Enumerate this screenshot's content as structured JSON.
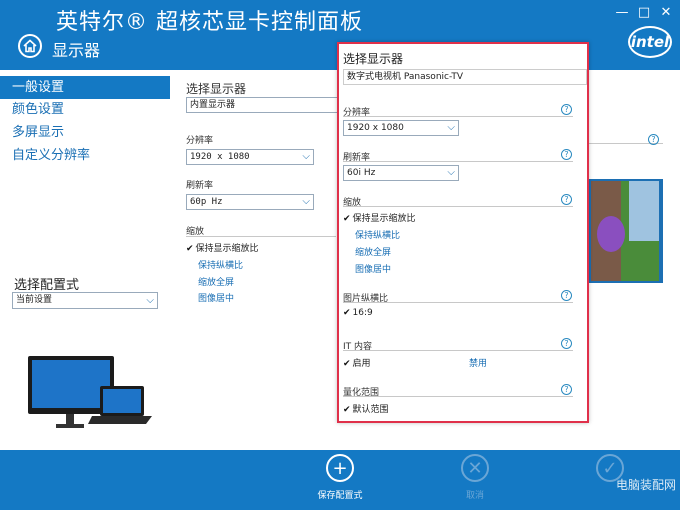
{
  "header": {
    "title": "英特尔® 超核芯显卡控制面板",
    "section": "显示器",
    "logo": "intel",
    "controls": {
      "minimize": "—",
      "maximize": "□",
      "close": "✕"
    }
  },
  "sidebar": {
    "items": [
      {
        "label": "一般设置",
        "active": true
      },
      {
        "label": "颜色设置",
        "active": false
      },
      {
        "label": "多屏显示",
        "active": false
      },
      {
        "label": "自定义分辨率",
        "active": false
      }
    ],
    "profile_label": "选择配置式",
    "profile_value": "当前设置"
  },
  "main": {
    "select_display_label": "选择显示器",
    "select_display_value": "内置显示器",
    "resolution_label": "分辨率",
    "resolution_value": "1920 x 1080",
    "refresh_label": "刷新率",
    "refresh_value": "60p Hz",
    "scaling_label": "缩放",
    "scaling_options": [
      {
        "label": "保持显示缩放比",
        "checked": true
      },
      {
        "label": "保持纵横比",
        "checked": false
      },
      {
        "label": "缩放全屏",
        "checked": false
      },
      {
        "label": "图像居中",
        "checked": false
      }
    ]
  },
  "popup": {
    "title": "选择显示器",
    "display_value": "数字式电视机 Panasonic-TV",
    "resolution_label": "分辨率",
    "resolution_value": "1920 x 1080",
    "refresh_label": "刷新率",
    "refresh_value": "60i Hz",
    "scaling_label": "缩放",
    "scaling_options": [
      {
        "label": "保持显示缩放比",
        "checked": true
      },
      {
        "label": "保持纵横比",
        "checked": false
      },
      {
        "label": "缩放全屏",
        "checked": false
      },
      {
        "label": "图像居中",
        "checked": false
      }
    ],
    "aspect_label": "图片纵横比",
    "aspect_value": "16:9",
    "it_label": "IT 内容",
    "it_enable": "启用",
    "it_disable": "禁用",
    "quant_label": "量化范围",
    "quant_value": "默认范围"
  },
  "footer": {
    "save_label": "保存配置式",
    "cancel_label": "取消",
    "watermark": "电脑装配网"
  },
  "colors": {
    "brand_blue": "#1479c4",
    "highlight_border": "#e0304a",
    "link_blue": "#1a6fb4"
  }
}
